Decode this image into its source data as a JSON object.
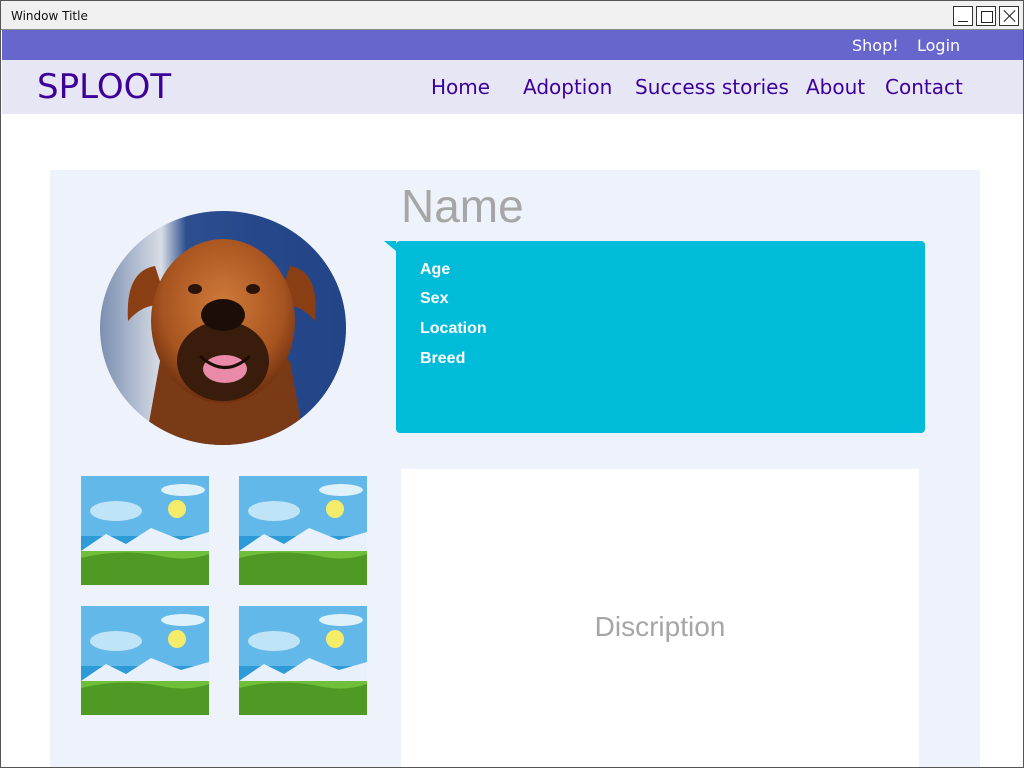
{
  "window": {
    "title": "Window Title"
  },
  "topbar": {
    "shop_label": "Shop!",
    "login_label": "Login"
  },
  "navbar": {
    "logo": "SPLOOT",
    "links": [
      "Home",
      "Adoption",
      "Success stories",
      "About",
      "Contact"
    ]
  },
  "profile": {
    "name_label": "Name",
    "fields": [
      "Age",
      "Sex",
      "Location",
      "Breed"
    ],
    "description_placeholder": "Discription"
  },
  "colors": {
    "topbar": "#6666cc",
    "navbar": "#e6e6f5",
    "brand_text": "#3d0099",
    "info_box": "#00bcd8",
    "panel": "#eef3fb"
  },
  "icons": {
    "minimize": "minimize-icon",
    "maximize": "maximize-icon",
    "close": "close-icon",
    "thumbnail": "image-placeholder-icon"
  }
}
